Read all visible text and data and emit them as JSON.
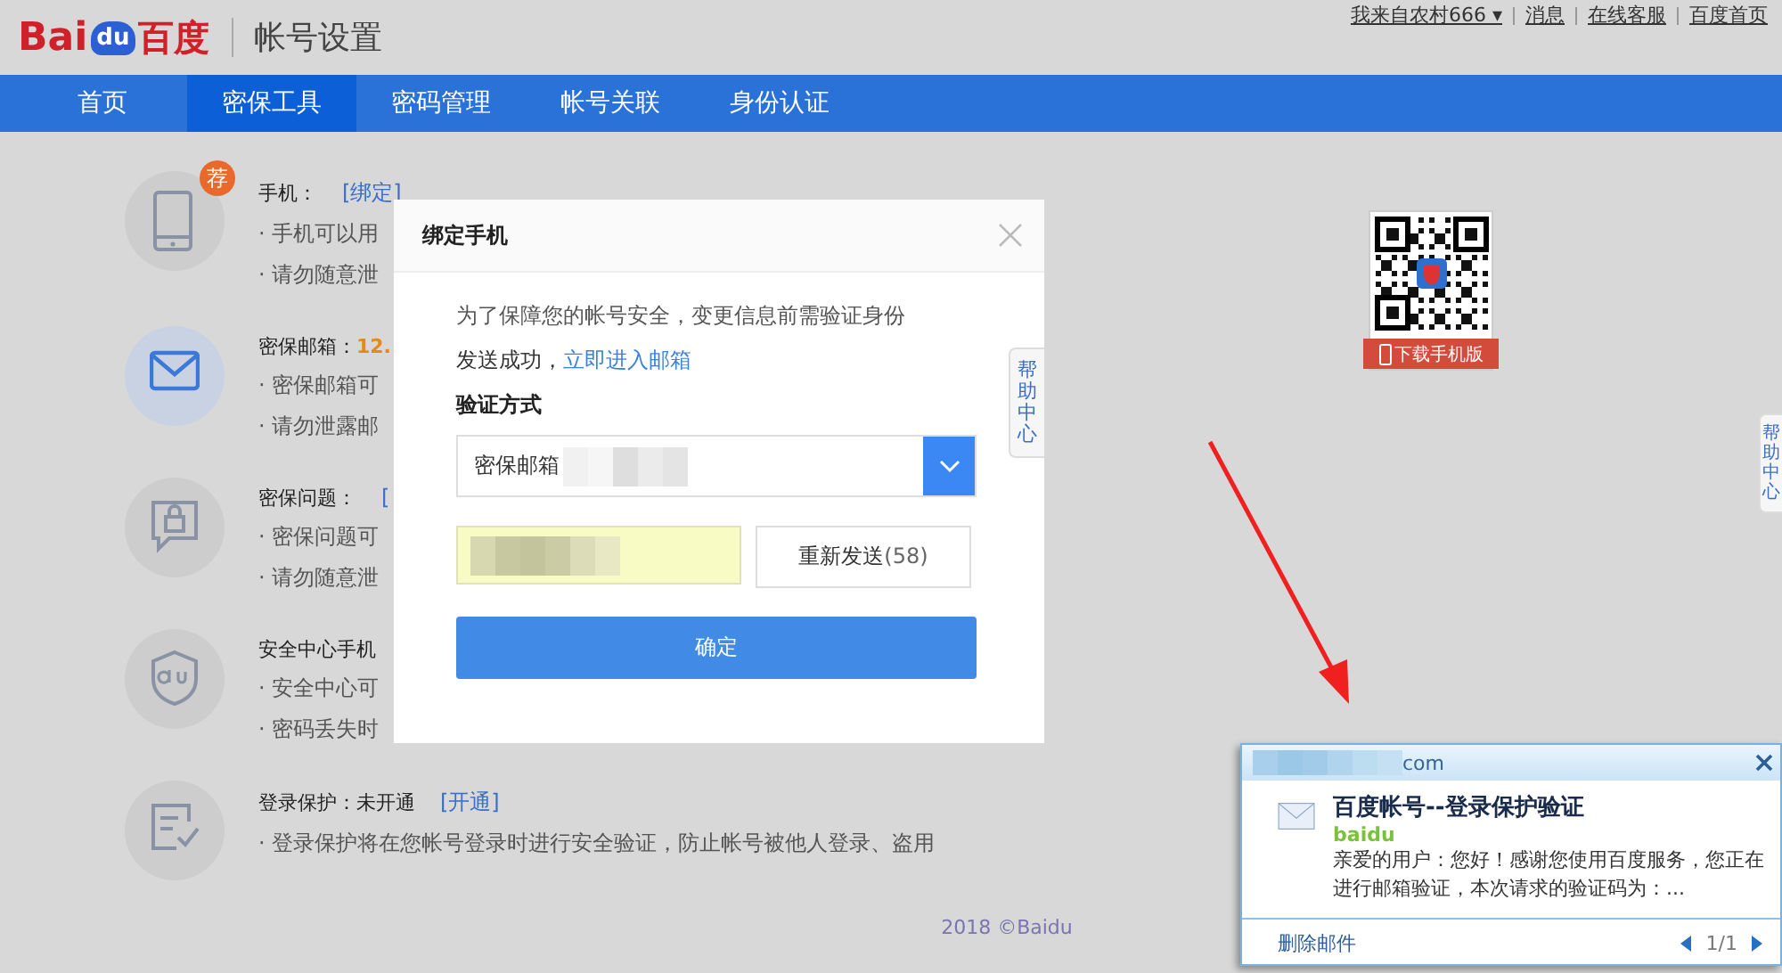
{
  "header": {
    "logo": {
      "latin": "Bai",
      "paw": "du",
      "chinese": "百度"
    },
    "title": "帐号设置",
    "user": "我来自农村666",
    "user_caret": "▾",
    "links": [
      "消息",
      "在线客服",
      "百度首页"
    ]
  },
  "nav": [
    {
      "label": "首页",
      "selected": false
    },
    {
      "label": "密保工具",
      "selected": true
    },
    {
      "label": "密码管理",
      "selected": false
    },
    {
      "label": "帐号关联",
      "selected": false
    },
    {
      "label": "身份认证",
      "selected": false
    }
  ],
  "security_items": [
    {
      "kind": "phone",
      "highlighted": false,
      "badge": "荐",
      "title": "手机：",
      "link": "[绑定]",
      "lines": [
        "· 手机可以用",
        "· 请勿随意泄"
      ]
    },
    {
      "kind": "email",
      "highlighted": true,
      "title": "密保邮箱：",
      "value": "12.",
      "lines": [
        "· 密保邮箱可",
        "· 请勿泄露邮"
      ]
    },
    {
      "kind": "question",
      "highlighted": false,
      "title": "密保问题：",
      "link": "[",
      "lines": [
        "· 密保问题可",
        "· 请勿随意泄"
      ]
    },
    {
      "kind": "app",
      "highlighted": false,
      "title": "安全中心手机",
      "lines": [
        "· 安全中心可",
        "· 密码丢失时"
      ]
    },
    {
      "kind": "login",
      "highlighted": false,
      "title": "登录保护：未开通",
      "link": "[开通]",
      "lines": [
        "· 登录保护将在您帐号登录时进行安全验证，防止帐号被他人登录、盗用"
      ]
    }
  ],
  "footer": "2018 ©Baidu",
  "qr_card": {
    "label": "下载手机版"
  },
  "help_tabs": [
    {
      "label": "帮助中心"
    },
    {
      "label": "帮助中心"
    }
  ],
  "modal": {
    "title": "绑定手机",
    "notice": "为了保障您的帐号安全，变更信息前需验证身份",
    "sent_text": "发送成功，",
    "sent_link": "立即进入邮箱",
    "method_label": "验证方式",
    "method_value": "密保邮箱",
    "resend_label": "重新发送",
    "resend_count": "(58)",
    "confirm": "确定"
  },
  "mail_popup": {
    "account_suffix": "com",
    "subject": "百度帐号--登录保护验证",
    "sender": "baidu",
    "preview": "亲爱的用户：您好！感谢您使用百度服务，您正在进行邮箱验证，本次请求的验证码为：...",
    "delete": "删除邮件",
    "pager": "1/1"
  }
}
